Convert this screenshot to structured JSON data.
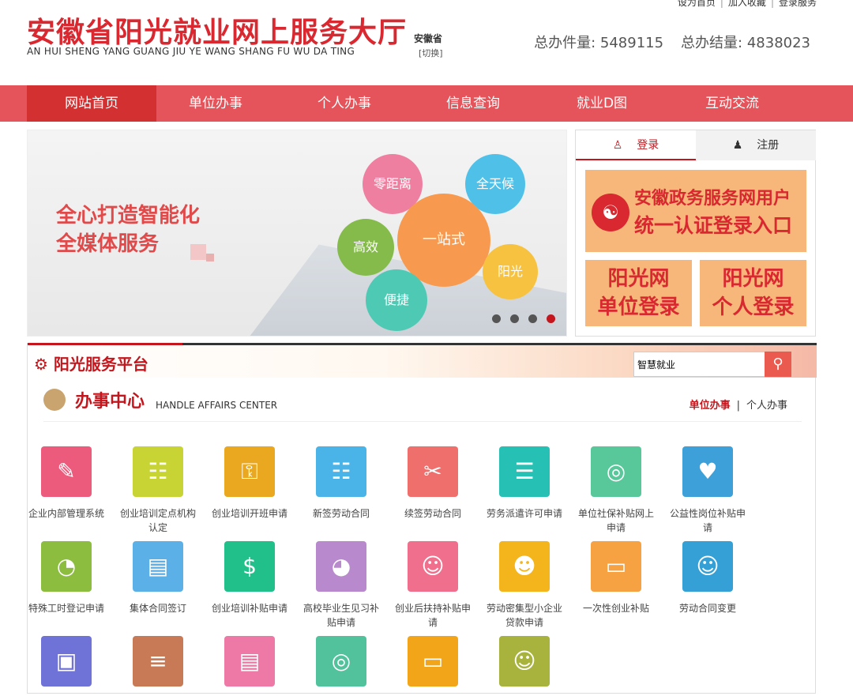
{
  "top_links": [
    "设为首页",
    "加入收藏",
    "登录服务"
  ],
  "header": {
    "logo_cn": "安徽省阳光就业网上服务大厅",
    "logo_en": "AN HUI SHENG YANG GUANG JIU YE WANG SHANG FU WU DA TING",
    "province": "安徽省",
    "switch": "[切换]",
    "total_handled": "总办件量: 5489115",
    "total_completed": "总办结量: 4838023"
  },
  "nav": [
    {
      "label": "网站首页",
      "active": true
    },
    {
      "label": "单位办事",
      "active": false
    },
    {
      "label": "个人办事",
      "active": false
    },
    {
      "label": "信息查询",
      "active": false
    },
    {
      "label": "就业D图",
      "active": false
    },
    {
      "label": "互动交流",
      "active": false
    }
  ],
  "banner": {
    "slogan1": "全心打造智能化",
    "slogan2": "全媒体服务",
    "bubbles": [
      "零距离",
      "全天候",
      "一站式",
      "高效",
      "阳光",
      "便捷"
    ]
  },
  "login": {
    "tab_login": "登录",
    "tab_register": "注册",
    "gov_line1": "安徽政务服务网用户",
    "gov_line2": "统一认证登录入口",
    "unit_line1": "阳光网",
    "unit_line2": "单位登录",
    "person_line1": "阳光网",
    "person_line2": "个人登录"
  },
  "platform": {
    "title": "阳光服务平台",
    "search_value": "智慧就业",
    "center_cn": "办事中心",
    "center_en": "HANDLE AFFAIRS CENTER",
    "link_unit": "单位办事",
    "link_person": "个人办事"
  },
  "services": [
    {
      "label": "企业内部管理系统",
      "color": "#ec5b7c",
      "icon": "clipboard-icon"
    },
    {
      "label": "创业培训定点机构认定",
      "color": "#c8d433",
      "icon": "network-icon"
    },
    {
      "label": "创业培训开班申请",
      "color": "#e9a81f",
      "icon": "document-lock-icon"
    },
    {
      "label": "新签劳动合同",
      "color": "#4ab4e8",
      "icon": "book-icon"
    },
    {
      "label": "续签劳动合同",
      "color": "#ef6f6c",
      "icon": "scroll-icon"
    },
    {
      "label": "劳务派遣许可申请",
      "color": "#27c0b4",
      "icon": "id-card-icon"
    },
    {
      "label": "单位社保补贴网上申请",
      "color": "#58c89a",
      "icon": "globe-laptop-icon"
    },
    {
      "label": "公益性岗位补贴申请",
      "color": "#3ea0d9",
      "icon": "heart-hand-icon"
    },
    {
      "label": "特殊工时登记申请",
      "color": "#8cbd3f",
      "icon": "gauge-icon"
    },
    {
      "label": "集体合同签订",
      "color": "#5cb0e8",
      "icon": "stack-icon"
    },
    {
      "label": "创业培训补贴申请",
      "color": "#21c08a",
      "icon": "money-bag-icon"
    },
    {
      "label": "高校毕业生见习补贴申请",
      "color": "#b889cc",
      "icon": "pie-icon"
    },
    {
      "label": "创业后扶持补贴申请",
      "color": "#ef6f8c",
      "icon": "people-icon"
    },
    {
      "label": "劳动密集型小企业贷款申请",
      "color": "#f3b51b",
      "icon": "group-icon"
    },
    {
      "label": "一次性创业补贴",
      "color": "#f6a243",
      "icon": "monitor-icon"
    },
    {
      "label": "劳动合同变更",
      "color": "#35a0d6",
      "icon": "contact-book-icon"
    },
    {
      "label": "",
      "color": "#6f72d6",
      "icon": "briefcase-icon"
    },
    {
      "label": "",
      "color": "#c77a55",
      "icon": "cabinet-icon"
    },
    {
      "label": "",
      "color": "#ee78a6",
      "icon": "stack-icon"
    },
    {
      "label": "",
      "color": "#52c29c",
      "icon": "globe-laptop-icon"
    },
    {
      "label": "",
      "color": "#f2a519",
      "icon": "laptop-icon"
    },
    {
      "label": "",
      "color": "#a7b33c",
      "icon": "user-desk-icon"
    }
  ]
}
